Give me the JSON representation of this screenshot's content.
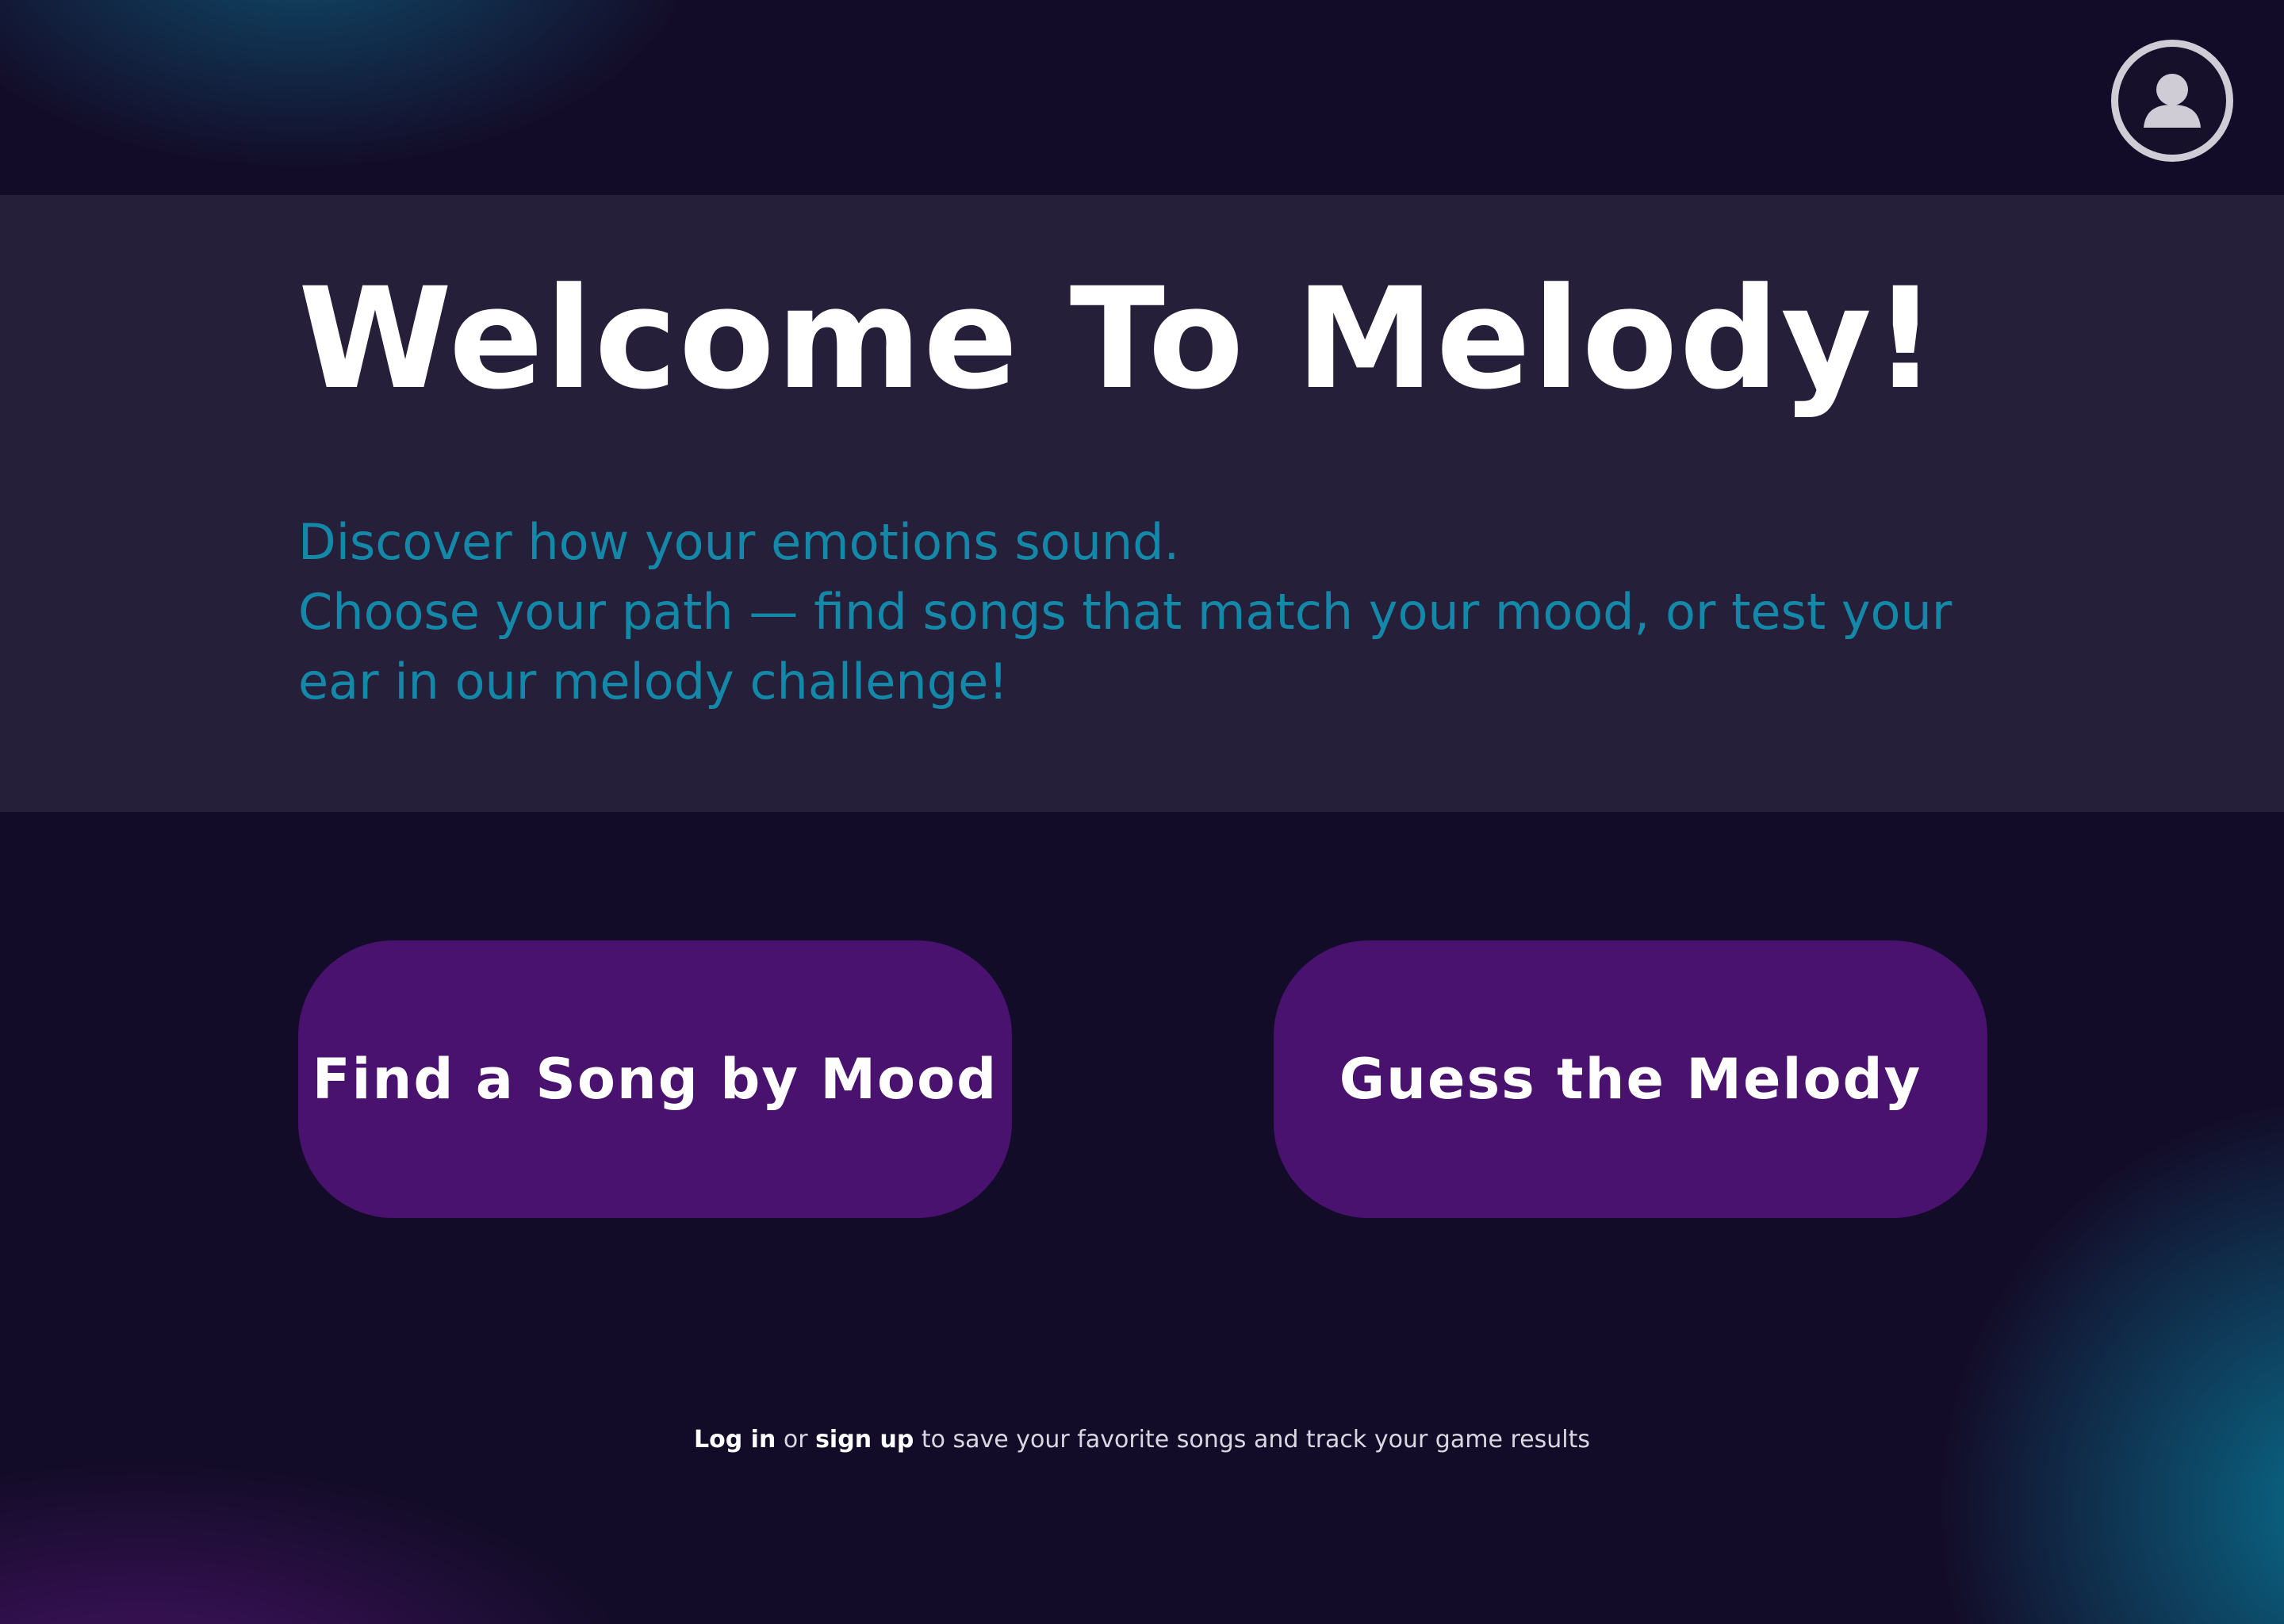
{
  "header": {
    "avatar_icon": "user-icon"
  },
  "hero": {
    "title": "Welcome To Melody!",
    "line1": "Discover how your emotions sound.",
    "line2": "Choose your path — find songs that match your mood, or test your",
    "line3": "ear in our melody challenge!"
  },
  "actions": {
    "mood_label": "Find a Song by Mood",
    "melody_label": "Guess the Melody"
  },
  "footer": {
    "login_label": "Log in",
    "or_text": " or ",
    "signup_label": "sign up",
    "tail_text": " to save your favorite songs and track your game results"
  },
  "colors": {
    "background": "#130c28",
    "hero_band": "#261f39",
    "accent_text": "#1488a8",
    "button": "#48126e",
    "text": "#ffffff"
  }
}
